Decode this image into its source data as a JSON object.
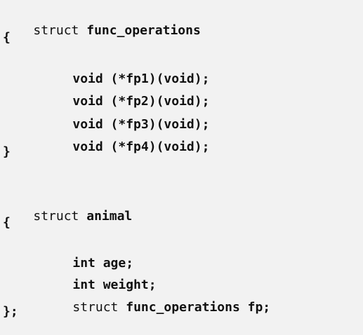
{
  "code": {
    "struct1": {
      "keyword": "struct",
      "name": "func_operations",
      "open_brace": "{",
      "members": [
        "void (*fp1)(void);",
        "void (*fp2)(void);",
        "void (*fp3)(void);",
        "void (*fp4)(void);"
      ],
      "close_brace": "}"
    },
    "struct2": {
      "keyword": "struct",
      "name": "animal",
      "open_brace": "{",
      "members": [
        "int age;",
        "int weight;"
      ],
      "member3_keyword": "struct",
      "member3_rest": "func_operations fp;",
      "close_brace": "};"
    }
  }
}
